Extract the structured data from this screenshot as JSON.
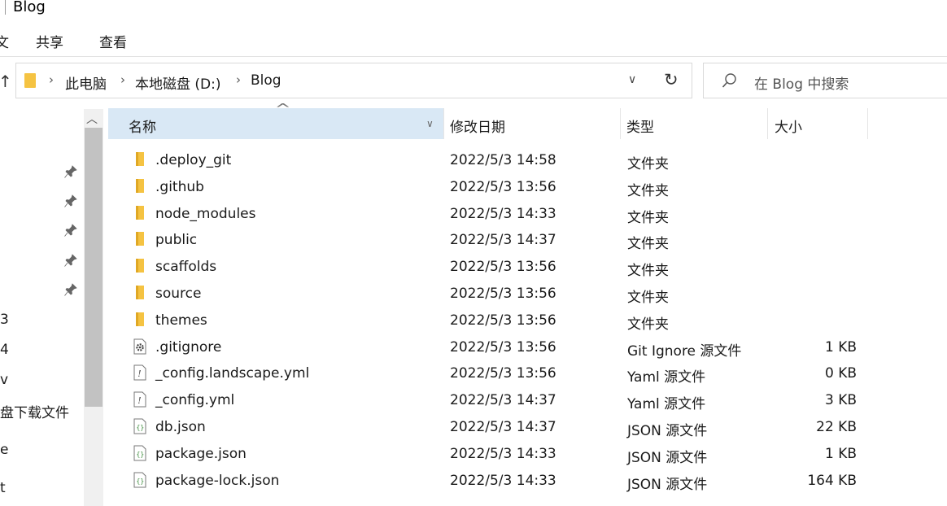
{
  "window": {
    "title": "Blog"
  },
  "ribbon": {
    "cut_label": "文",
    "share_label": "共享",
    "view_label": "查看"
  },
  "address": {
    "crumbs": [
      "此电脑",
      "本地磁盘 (D:)",
      "Blog"
    ],
    "search_placeholder": "在 Blog 中搜索"
  },
  "nav": {
    "visible_items": [
      "3",
      "4",
      "v",
      "盘下载文件",
      "e",
      "t"
    ]
  },
  "columns": {
    "name": "名称",
    "date": "修改日期",
    "type": "类型",
    "size": "大小"
  },
  "files": [
    {
      "name": ".deploy_git",
      "date": "2022/5/3 14:58",
      "type": "文件夹",
      "size": "",
      "icon": "folder-icon"
    },
    {
      "name": ".github",
      "date": "2022/5/3 13:56",
      "type": "文件夹",
      "size": "",
      "icon": "folder-icon"
    },
    {
      "name": "node_modules",
      "date": "2022/5/3 14:33",
      "type": "文件夹",
      "size": "",
      "icon": "folder-icon"
    },
    {
      "name": "public",
      "date": "2022/5/3 14:37",
      "type": "文件夹",
      "size": "",
      "icon": "folder-icon"
    },
    {
      "name": "scaffolds",
      "date": "2022/5/3 13:56",
      "type": "文件夹",
      "size": "",
      "icon": "folder-icon"
    },
    {
      "name": "source",
      "date": "2022/5/3 13:56",
      "type": "文件夹",
      "size": "",
      "icon": "folder-icon"
    },
    {
      "name": "themes",
      "date": "2022/5/3 13:56",
      "type": "文件夹",
      "size": "",
      "icon": "folder-icon"
    },
    {
      "name": ".gitignore",
      "date": "2022/5/3 13:56",
      "type": "Git Ignore 源文件",
      "size": "1 KB",
      "icon": "gear-file-icon"
    },
    {
      "name": "_config.landscape.yml",
      "date": "2022/5/3 13:56",
      "type": "Yaml 源文件",
      "size": "0 KB",
      "icon": "yaml-file-icon"
    },
    {
      "name": "_config.yml",
      "date": "2022/5/3 14:37",
      "type": "Yaml 源文件",
      "size": "3 KB",
      "icon": "yaml-file-icon"
    },
    {
      "name": "db.json",
      "date": "2022/5/3 14:37",
      "type": "JSON 源文件",
      "size": "22 KB",
      "icon": "json-file-icon"
    },
    {
      "name": "package.json",
      "date": "2022/5/3 14:33",
      "type": "JSON 源文件",
      "size": "1 KB",
      "icon": "json-file-icon"
    },
    {
      "name": "package-lock.json",
      "date": "2022/5/3 14:33",
      "type": "JSON 源文件",
      "size": "164 KB",
      "icon": "json-file-icon"
    }
  ],
  "colors": {
    "folder": "#f5c342",
    "header_active": "#d9e8f5",
    "json_icon": "#3a8a3a",
    "scroll_thumb": "#c2c2c2"
  }
}
